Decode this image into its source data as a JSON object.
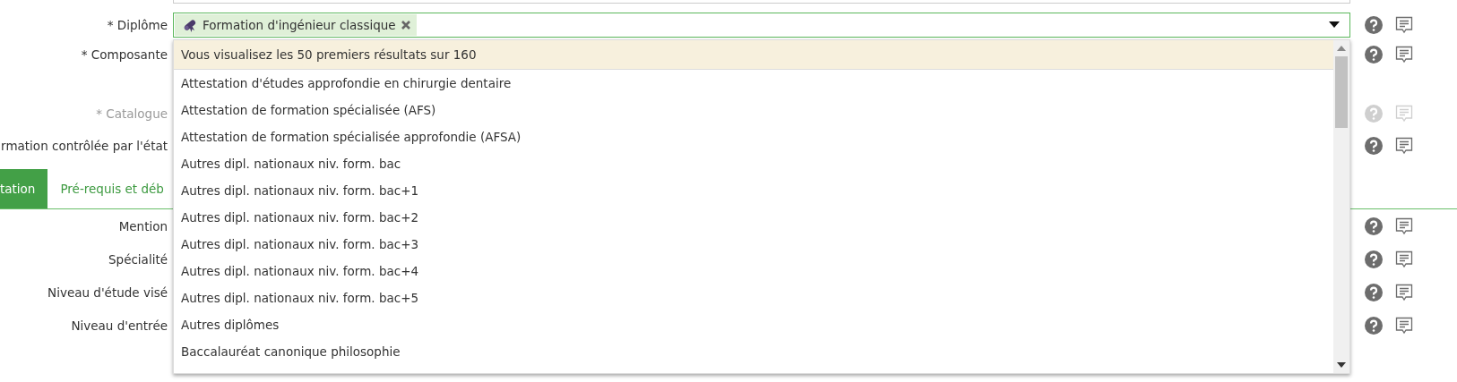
{
  "rows_top": [
    {
      "label": "* Diplôme",
      "disabled": false
    },
    {
      "label": "* Composante",
      "disabled": false
    },
    {
      "label": "* Catalogue",
      "disabled": true
    },
    {
      "label": "rmation contrôlée par l'état",
      "disabled": false
    }
  ],
  "diplome_select": {
    "chip": "Formation d'ingénieur classique"
  },
  "tabs": [
    {
      "label": "tation",
      "selected": true
    },
    {
      "label": "Pré-requis et déb",
      "selected": false
    }
  ],
  "rows_bottom": [
    {
      "label": "Mention",
      "disabled": false
    },
    {
      "label": "Spécialité",
      "disabled": false
    },
    {
      "label": "Niveau d'étude visé",
      "disabled": false
    },
    {
      "label": "Niveau d'entrée",
      "disabled": false
    }
  ],
  "dropdown": {
    "notice": "Vous visualisez les 50 premiers résultats sur 160",
    "options": [
      "Attestation d'études approfondie en chirurgie dentaire",
      "Attestation de formation spécialisée (AFS)",
      "Attestation de formation spécialisée approfondie (AFSA)",
      "Autres dipl. nationaux niv. form. bac",
      "Autres dipl. nationaux niv. form. bac+1",
      "Autres dipl. nationaux niv. form. bac+2",
      "Autres dipl. nationaux niv. form. bac+3",
      "Autres dipl. nationaux niv. form. bac+4",
      "Autres dipl. nationaux niv. form. bac+5",
      "Autres diplômes",
      "Baccalauréat canonique philosophie"
    ]
  }
}
